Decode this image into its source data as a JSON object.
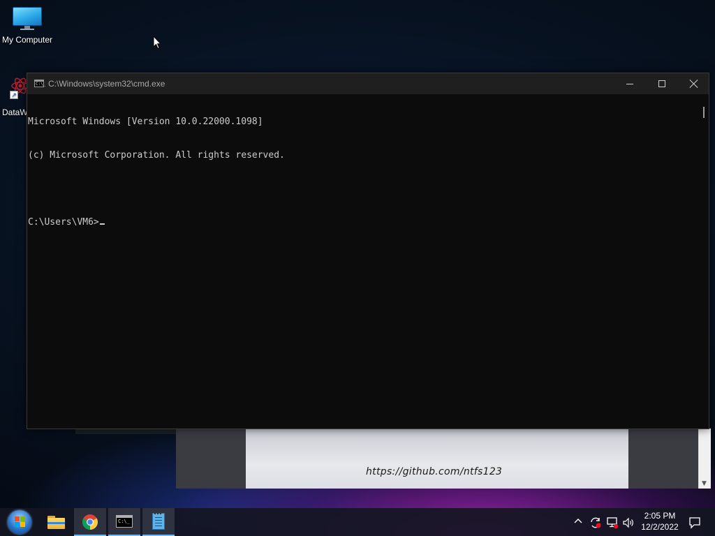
{
  "desktop": {
    "icons": [
      {
        "label": "My Computer",
        "icon": "monitor-icon"
      },
      {
        "label": "DataW",
        "icon": "datawrapper-icon"
      }
    ]
  },
  "background_window": {
    "watermark": "https://github.com/ntfs123"
  },
  "cmd_window": {
    "title": "C:\\Windows\\system32\\cmd.exe",
    "app_icon_text": "C:\\_",
    "lines": [
      "Microsoft Windows [Version 10.0.22000.1098]",
      "(c) Microsoft Corporation. All rights reserved.",
      "",
      "C:\\Users\\VM6>"
    ]
  },
  "taskbar": {
    "buttons": [
      {
        "name": "start",
        "icon": "windows-orb-icon"
      },
      {
        "name": "file-explorer",
        "icon": "folder-icon"
      },
      {
        "name": "chrome",
        "icon": "chrome-icon"
      },
      {
        "name": "command-prompt",
        "icon": "cmd-icon"
      },
      {
        "name": "notepad",
        "icon": "notepad-icon"
      }
    ],
    "clock": {
      "time": "2:05 PM",
      "date": "12/2/2022"
    }
  },
  "colors": {
    "console_bg": "#0c0c0c",
    "console_text": "#cccccc",
    "titlebar_bg": "#1f1f1f",
    "taskbar_active_underline": "#76b9ed"
  }
}
